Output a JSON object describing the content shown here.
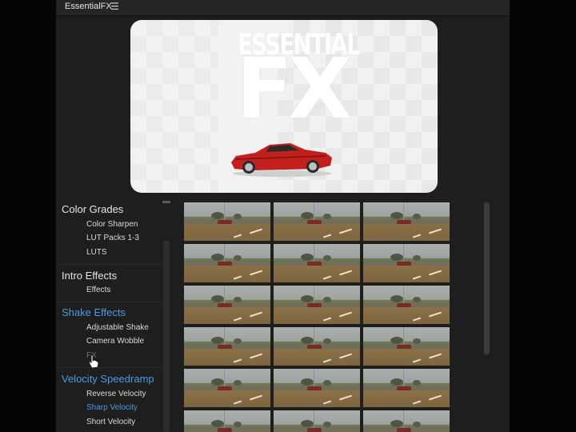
{
  "panel": {
    "title": "EssentialFX",
    "menu_icon": "hamburger-menu-icon"
  },
  "preview": {
    "logo_top": "ESSENTIAL",
    "logo_big": "FX"
  },
  "categories": [
    {
      "label": "Color Grades",
      "items": [
        "Color Sharpen",
        "LUT Packs 1-3",
        "LUTS"
      ]
    },
    {
      "label": "Intro Effects",
      "items": [
        "Effects"
      ]
    },
    {
      "label": "Shake Effects",
      "items": [
        "Adjustable Shake",
        "Camera Wobble",
        "FX"
      ]
    },
    {
      "label": "Velocity Speedramp",
      "items": [
        "Reverse Velocity",
        "Sharp Velocity",
        "Short Velocity"
      ]
    }
  ],
  "colors": {
    "panel_bg": "#1e1e1e",
    "accent": "#4a9ae4",
    "text": "#e6e6e6"
  },
  "thumbnail_grid": {
    "columns": 3,
    "visible_thumbnails": 18
  }
}
